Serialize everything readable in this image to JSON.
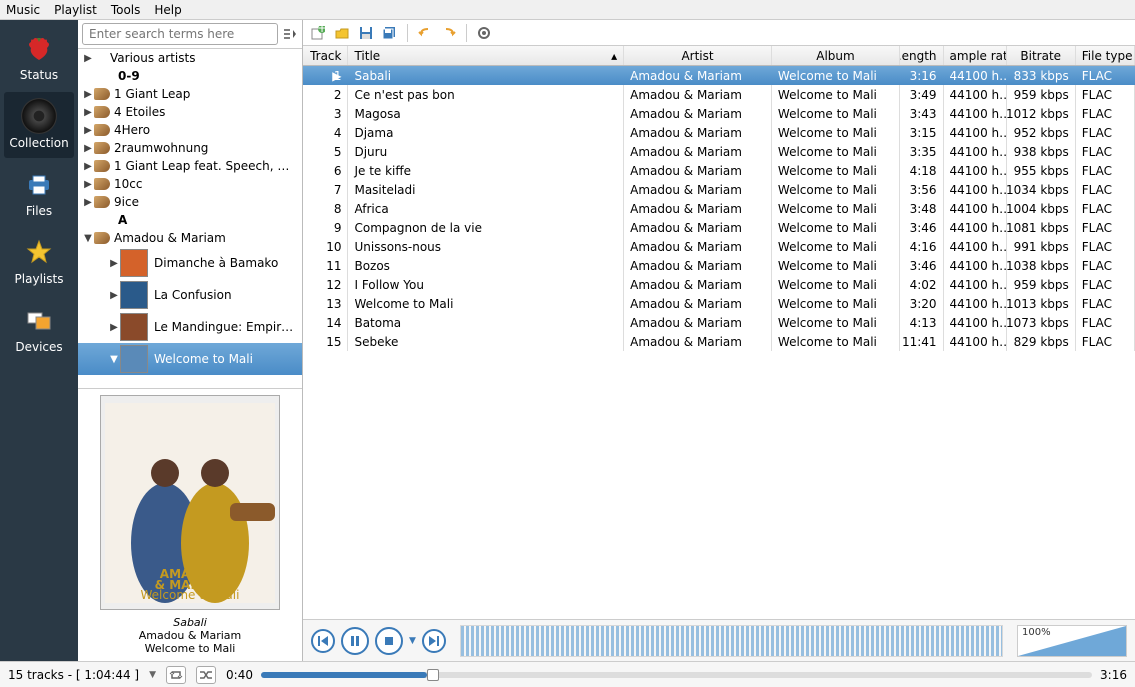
{
  "menu": {
    "music": "Music",
    "playlist": "Playlist",
    "tools": "Tools",
    "help": "Help"
  },
  "leftpanel": {
    "status": "Status",
    "collection": "Collection",
    "files": "Files",
    "playlists": "Playlists",
    "devices": "Devices"
  },
  "search": {
    "placeholder": "Enter search terms here"
  },
  "tree": {
    "various": "Various artists",
    "group09": "0-9",
    "artists09": [
      "1 Giant Leap",
      "4 Etoiles",
      "4Hero",
      "2raumwohnung",
      "1 Giant Leap feat. Speech, …",
      "10cc",
      "9ice"
    ],
    "groupA": "A",
    "amadou": "Amadou & Mariam",
    "albums": [
      "Dimanche à Bamako",
      "La Confusion",
      "Le Mandingue: Empir…",
      "Welcome to Mali"
    ]
  },
  "nowplaying": {
    "title": "Sabali",
    "artist": "Amadou & Mariam",
    "album": "Welcome to Mali"
  },
  "columns": {
    "track": "Track",
    "title": "Title",
    "artist": "Artist",
    "album": "Album",
    "length": ".ength",
    "sample": "ample rate",
    "bitrate": "Bitrate",
    "filetype": "File type"
  },
  "tracks": [
    {
      "n": "1",
      "title": "Sabali",
      "artist": "Amadou & Mariam",
      "album": "Welcome to Mali",
      "len": "3:16",
      "sr": "44100 h…",
      "br": "833 kbps",
      "ft": "FLAC"
    },
    {
      "n": "2",
      "title": "Ce n'est pas bon",
      "artist": "Amadou & Mariam",
      "album": "Welcome to Mali",
      "len": "3:49",
      "sr": "44100 h…",
      "br": "959 kbps",
      "ft": "FLAC"
    },
    {
      "n": "3",
      "title": "Magosa",
      "artist": "Amadou & Mariam",
      "album": "Welcome to Mali",
      "len": "3:43",
      "sr": "44100 h…",
      "br": "1012 kbps",
      "ft": "FLAC"
    },
    {
      "n": "4",
      "title": "Djama",
      "artist": "Amadou & Mariam",
      "album": "Welcome to Mali",
      "len": "3:15",
      "sr": "44100 h…",
      "br": "952 kbps",
      "ft": "FLAC"
    },
    {
      "n": "5",
      "title": "Djuru",
      "artist": "Amadou & Mariam",
      "album": "Welcome to Mali",
      "len": "3:35",
      "sr": "44100 h…",
      "br": "938 kbps",
      "ft": "FLAC"
    },
    {
      "n": "6",
      "title": "Je te kiffe",
      "artist": "Amadou & Mariam",
      "album": "Welcome to Mali",
      "len": "4:18",
      "sr": "44100 h…",
      "br": "955 kbps",
      "ft": "FLAC"
    },
    {
      "n": "7",
      "title": "Masiteladi",
      "artist": "Amadou & Mariam",
      "album": "Welcome to Mali",
      "len": "3:56",
      "sr": "44100 h…",
      "br": "1034 kbps",
      "ft": "FLAC"
    },
    {
      "n": "8",
      "title": "Africa",
      "artist": "Amadou & Mariam",
      "album": "Welcome to Mali",
      "len": "3:48",
      "sr": "44100 h…",
      "br": "1004 kbps",
      "ft": "FLAC"
    },
    {
      "n": "9",
      "title": "Compagnon de la vie",
      "artist": "Amadou & Mariam",
      "album": "Welcome to Mali",
      "len": "3:46",
      "sr": "44100 h…",
      "br": "1081 kbps",
      "ft": "FLAC"
    },
    {
      "n": "10",
      "title": "Unissons-nous",
      "artist": "Amadou & Mariam",
      "album": "Welcome to Mali",
      "len": "4:16",
      "sr": "44100 h…",
      "br": "991 kbps",
      "ft": "FLAC"
    },
    {
      "n": "11",
      "title": "Bozos",
      "artist": "Amadou & Mariam",
      "album": "Welcome to Mali",
      "len": "3:46",
      "sr": "44100 h…",
      "br": "1038 kbps",
      "ft": "FLAC"
    },
    {
      "n": "12",
      "title": "I Follow You",
      "artist": "Amadou & Mariam",
      "album": "Welcome to Mali",
      "len": "4:02",
      "sr": "44100 h…",
      "br": "959 kbps",
      "ft": "FLAC"
    },
    {
      "n": "13",
      "title": "Welcome to Mali",
      "artist": "Amadou & Mariam",
      "album": "Welcome to Mali",
      "len": "3:20",
      "sr": "44100 h…",
      "br": "1013 kbps",
      "ft": "FLAC"
    },
    {
      "n": "14",
      "title": "Batoma",
      "artist": "Amadou & Mariam",
      "album": "Welcome to Mali",
      "len": "4:13",
      "sr": "44100 h…",
      "br": "1073 kbps",
      "ft": "FLAC"
    },
    {
      "n": "15",
      "title": "Sebeke",
      "artist": "Amadou & Mariam",
      "album": "Welcome to Mali",
      "len": "11:41",
      "sr": "44100 h…",
      "br": "829 kbps",
      "ft": "FLAC"
    }
  ],
  "volume": "100%",
  "bottom": {
    "summary": "15 tracks - [ 1:04:44 ]",
    "pos": "0:40",
    "dur": "3:16"
  }
}
